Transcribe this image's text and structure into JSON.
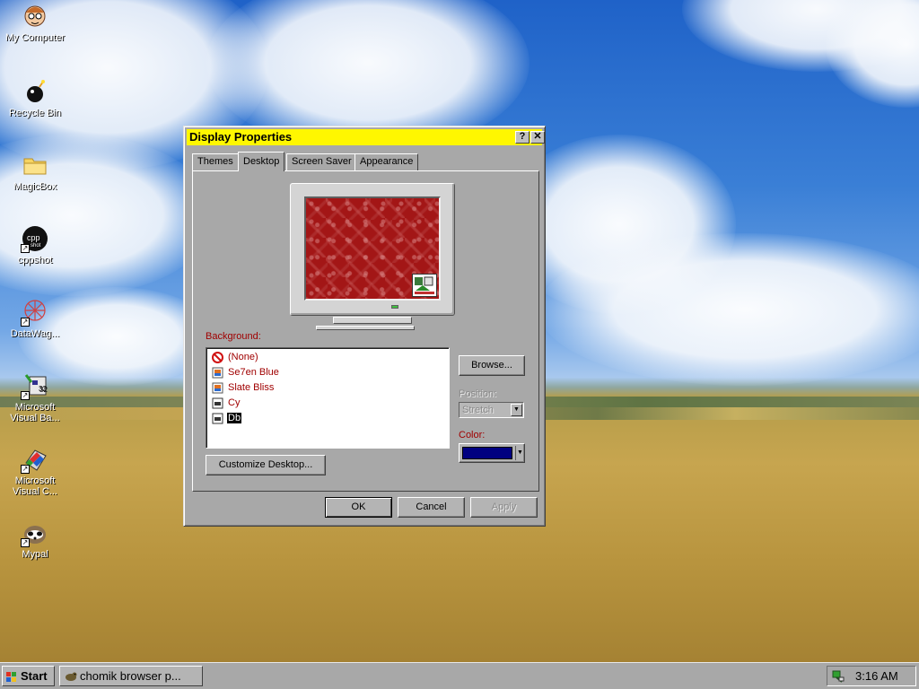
{
  "desktop": {
    "icons": [
      {
        "label": "My Computer",
        "icon": "my-computer-icon"
      },
      {
        "label": "Recycle Bin",
        "icon": "recycle-bin-icon"
      },
      {
        "label": "MagicBox",
        "icon": "folder-icon"
      },
      {
        "label": "cppshot",
        "icon": "cppshot-icon"
      },
      {
        "label": "DataWag...",
        "icon": "datawagon-icon"
      },
      {
        "label": "Microsoft Visual Ba...",
        "icon": "visual-basic-icon"
      },
      {
        "label": "Microsoft Visual C...",
        "icon": "visual-c-icon"
      },
      {
        "label": "Mypal",
        "icon": "mypal-icon"
      }
    ]
  },
  "window": {
    "title": "Display Properties",
    "help_glyph": "?",
    "close_glyph": "✕",
    "tabs": [
      {
        "label": "Themes",
        "active": false
      },
      {
        "label": "Desktop",
        "active": true
      },
      {
        "label": "Screen Saver",
        "active": false
      },
      {
        "label": "Appearance",
        "active": false
      }
    ],
    "background_label": "Background:",
    "background_items": [
      {
        "label": "(None)",
        "icon": "none-icon",
        "selected": false
      },
      {
        "label": "Se7en Blue",
        "icon": "image-file-icon",
        "selected": false
      },
      {
        "label": "Slate Bliss",
        "icon": "image-file-icon",
        "selected": false
      },
      {
        "label": "Cy",
        "icon": "bitmap-file-icon",
        "selected": false
      },
      {
        "label": "Db",
        "icon": "bitmap-file-icon",
        "selected": true
      }
    ],
    "browse_label": "Browse...",
    "position_label": "Position:",
    "position_value": "Stretch",
    "color_label": "Color:",
    "color_value": "#000080",
    "customize_label": "Customize Desktop...",
    "ok_label": "OK",
    "cancel_label": "Cancel",
    "apply_label": "Apply",
    "colors": {
      "title_bar": "#fff700",
      "dialog_face": "#a8a8a8",
      "label_red": "#a00000",
      "preview_wallpaper": "#a31616"
    }
  },
  "taskbar": {
    "start_label": "Start",
    "task_label": "chomik browser p...",
    "clock": "3:16 AM"
  }
}
